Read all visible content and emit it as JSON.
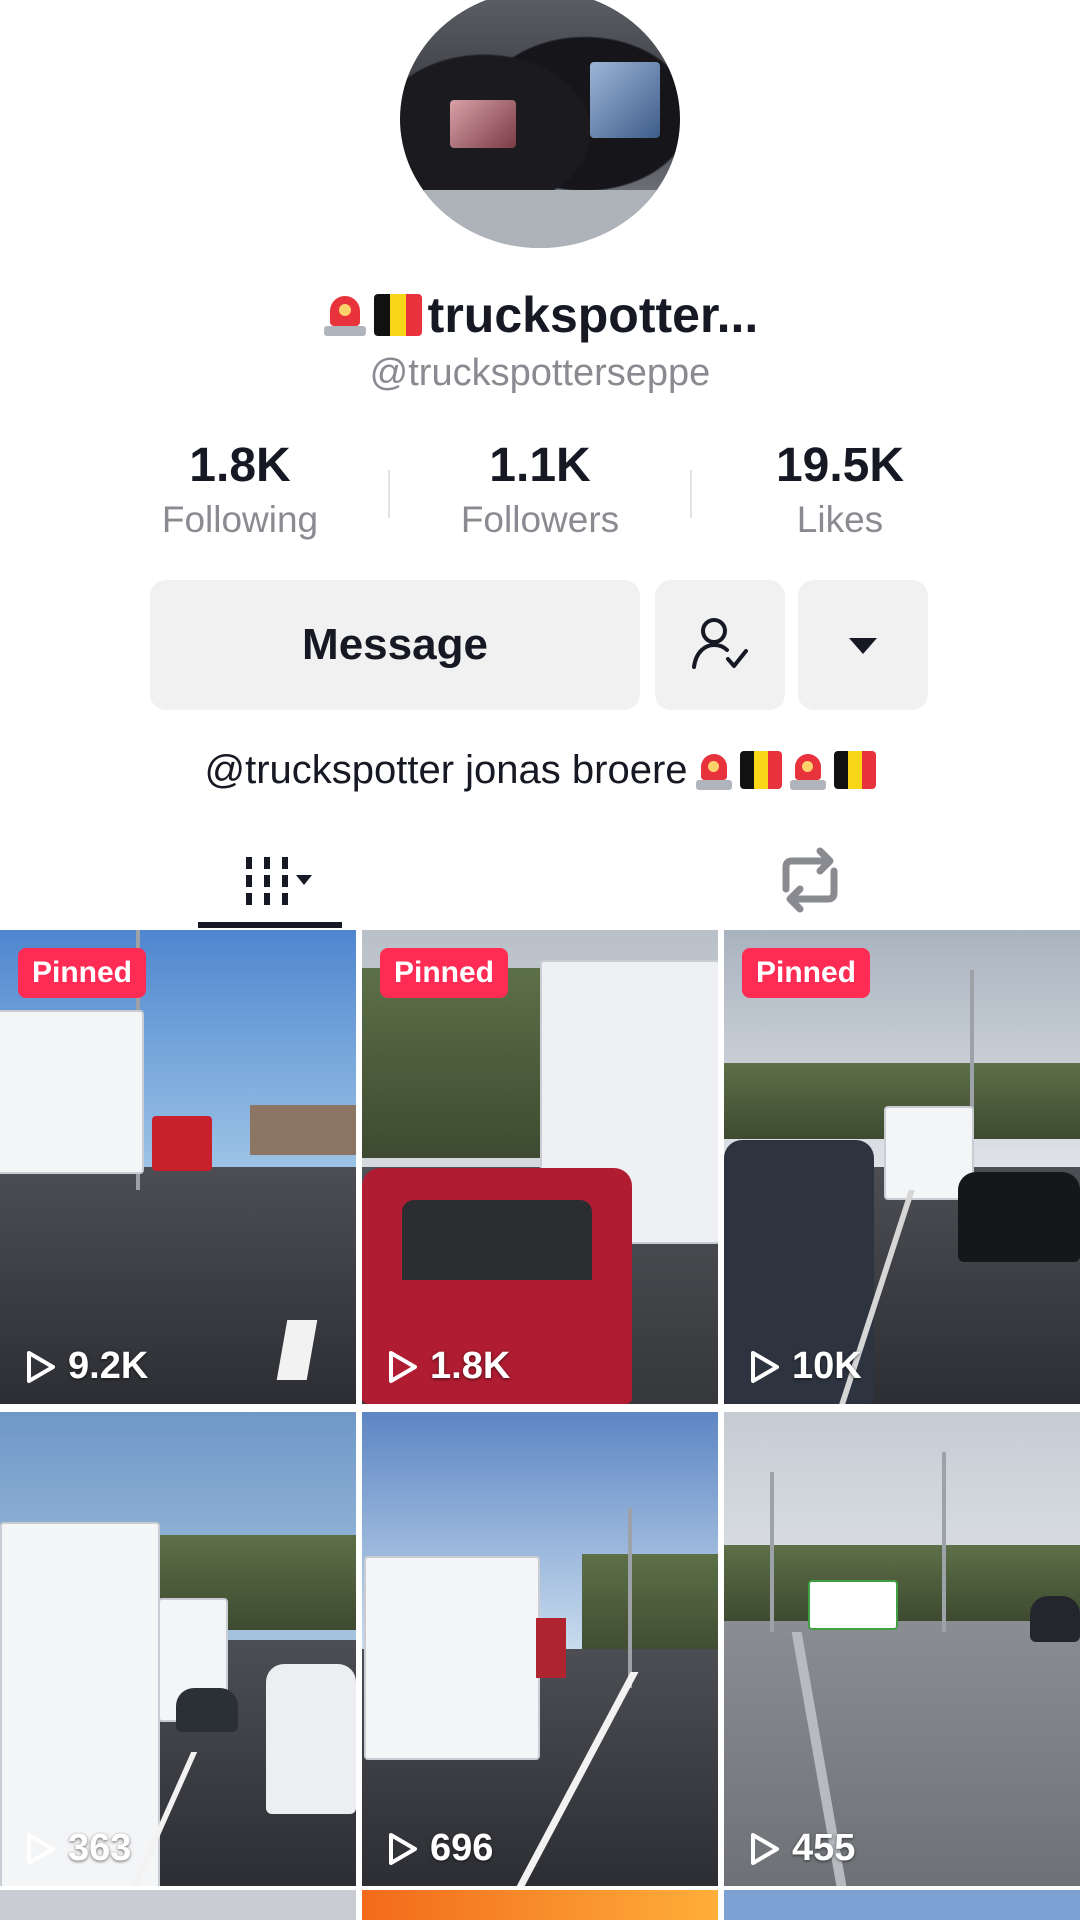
{
  "profile": {
    "display_name": "truckspotter...",
    "handle": "@truckspotterseppe",
    "bio": "@truckspotter jonas broere",
    "stats": [
      {
        "value": "1.8K",
        "label": "Following"
      },
      {
        "value": "1.1K",
        "label": "Followers"
      },
      {
        "value": "19.5K",
        "label": "Likes"
      }
    ]
  },
  "actions": {
    "message_label": "Message"
  },
  "videos": [
    {
      "badge": "Pinned",
      "views": "9.2K"
    },
    {
      "badge": "Pinned",
      "views": "1.8K"
    },
    {
      "badge": "Pinned",
      "views": "10K"
    },
    {
      "badge": "",
      "views": "363"
    },
    {
      "badge": "",
      "views": "696"
    },
    {
      "badge": "",
      "views": "455"
    }
  ],
  "icons": {
    "siren": "police-light-icon",
    "flag": "belgium-flag-icon",
    "friend": "user-check-icon",
    "more": "caret-down-icon",
    "videos_tab": "grid-icon",
    "repost_tab": "repost-icon",
    "play": "play-icon"
  },
  "colors": {
    "accent": "#fe2c55",
    "text": "#161823",
    "muted": "#8a8b91",
    "button_bg": "#f1f1f2"
  }
}
